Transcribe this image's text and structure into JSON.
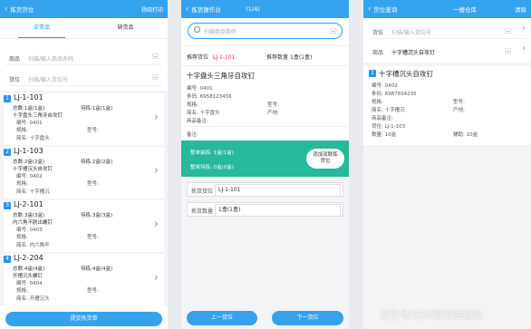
{
  "left": {
    "header": {
      "title": "拣货货位",
      "action": "杨晓打印"
    },
    "tabs": [
      "正常品",
      "缺货品"
    ],
    "product_label": "商品",
    "product_placeholder": "扫描/输入商品名码",
    "location_label": "货位",
    "location_placeholder": "扫描/输入货位号",
    "items": [
      {
        "num": "1",
        "loc": "LJ-1-101",
        "total": "总数:1盒(1盒)",
        "pending": "待拣:1盒(1盒)",
        "name": "十字盘头三角牙自攻钉",
        "code": "编号: 0401",
        "spec": "规格:",
        "model": "型号:",
        "brand": "简名: 十字盘头"
      },
      {
        "num": "2",
        "loc": "LJ-1-103",
        "total": "总数:2盒(2盒)",
        "pending": "待拣:2盒(2盒)",
        "name": "十字槽沉头自攻钉",
        "code": "编号: 0402",
        "spec": "规格:",
        "model": "型号:",
        "brand": "简名: 十字槽沉"
      },
      {
        "num": "3",
        "loc": "LJ-2-101",
        "total": "总数:3盒(3盒)",
        "pending": "待拣:3盒(3盒)",
        "name": "内六角不脱出螺钉",
        "code": "编号: 0403",
        "spec": "规格:",
        "model": "型号:",
        "brand": "简名: 内六角不"
      },
      {
        "num": "4",
        "loc": "LJ-2-204",
        "total": "总数:4盒(4盒)",
        "pending": "待拣:4盒(4盒)",
        "name": "开槽沉头螺钉",
        "code": "编号: 0404",
        "spec": "规格:",
        "model": "型号:",
        "brand": "简名: 开槽沉头"
      }
    ],
    "submit": "提交拣货单"
  },
  "middle": {
    "header": {
      "title": "拣货操作台",
      "progress": "(1/4)"
    },
    "scan_placeholder": "扫描商品条码",
    "rec_loc_label": "推荐货位",
    "rec_loc_value": "LJ-1-101",
    "rec_qty_label": "推荐数量",
    "rec_qty_value": "1盒(1盒)",
    "product_name": "十字盘头三角牙自攻钉",
    "details": [
      {
        "k": "编号:",
        "v": "0401"
      },
      {
        "k": "条码:",
        "v": "6958123456"
      },
      {
        "k": "规格:",
        "v": ""
      },
      {
        "k": "简名:",
        "v": "十字盘头"
      },
      {
        "k": "商品备注:",
        "v": ""
      }
    ],
    "model_label": "型号:",
    "origin_label": "产地:",
    "remark_label": "备注:",
    "green": {
      "line1": "整单装拣: 1盒(1盒)",
      "line2": "整单待拣: 0盒(0盒)",
      "button": "添加双联拣货位"
    },
    "pick_loc_label": "拣货货位",
    "pick_loc_value": "LJ-1-101",
    "pick_qty_label": "拣货数量",
    "pick_qty_value": "1盒(1盒)",
    "prev": "上一货位",
    "next": "下一货位"
  },
  "right": {
    "header": {
      "title": "货位查询",
      "center": "一楼仓库",
      "action": "清除"
    },
    "loc_label": "货位",
    "loc_placeholder": "扫描/输入货位号",
    "product_label": "商品",
    "product_value": "十字槽沉头自攻钉",
    "num": "1",
    "item_name": "十字槽沉头自攻钉",
    "rows": [
      {
        "k": "编号:",
        "v": "0402"
      },
      {
        "k": "条码:",
        "v": "6987834235"
      },
      {
        "k": "规格:",
        "v": ""
      },
      {
        "k": "简名:",
        "v": "十字槽沉"
      },
      {
        "k": "商品备注:",
        "v": ""
      },
      {
        "k": "货位:",
        "v": "LJ-1-103"
      }
    ],
    "model_label": "型号:",
    "origin_label": "产地:",
    "qty_label": "数量:",
    "qty_value": "10盒",
    "aux_label": "辅助:",
    "aux_value": "10盒"
  },
  "watermark": "百家号/苏州管家婆服务"
}
